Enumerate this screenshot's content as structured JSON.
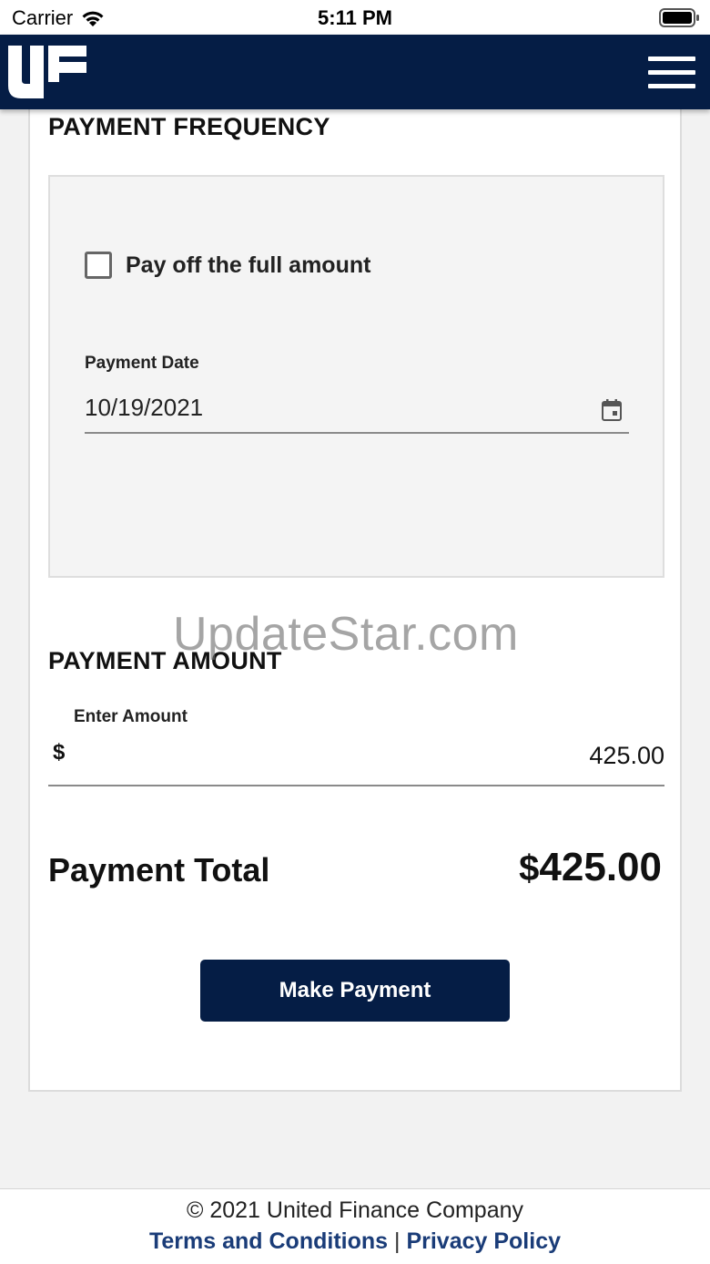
{
  "status_bar": {
    "carrier": "Carrier",
    "time": "5:11 PM"
  },
  "header": {
    "logo_alt": "UF"
  },
  "payment_frequency": {
    "title": "PAYMENT FREQUENCY",
    "checkbox_label": "Pay off the full amount",
    "checkbox_checked": false,
    "date_label": "Payment Date",
    "date_value": "10/19/2021"
  },
  "payment_amount": {
    "title": "PAYMENT AMOUNT",
    "field_label": "Enter Amount",
    "currency": "$",
    "value": "425.00"
  },
  "total": {
    "label": "Payment Total",
    "currency": "$",
    "value": "425.00"
  },
  "actions": {
    "make_payment": "Make Payment"
  },
  "watermark": "UpdateStar.com",
  "footer": {
    "copyright": "© 2021 United Finance Company",
    "terms": "Terms and Conditions",
    "separator": "|",
    "privacy": "Privacy Policy"
  },
  "colors": {
    "brand_navy": "#051d45",
    "link_blue": "#1a3c78",
    "background": "#f2f2f2",
    "panel": "#f4f4f4"
  },
  "icons": [
    "wifi-icon",
    "battery-icon",
    "menu-icon",
    "calendar-icon",
    "checkbox-icon"
  ]
}
